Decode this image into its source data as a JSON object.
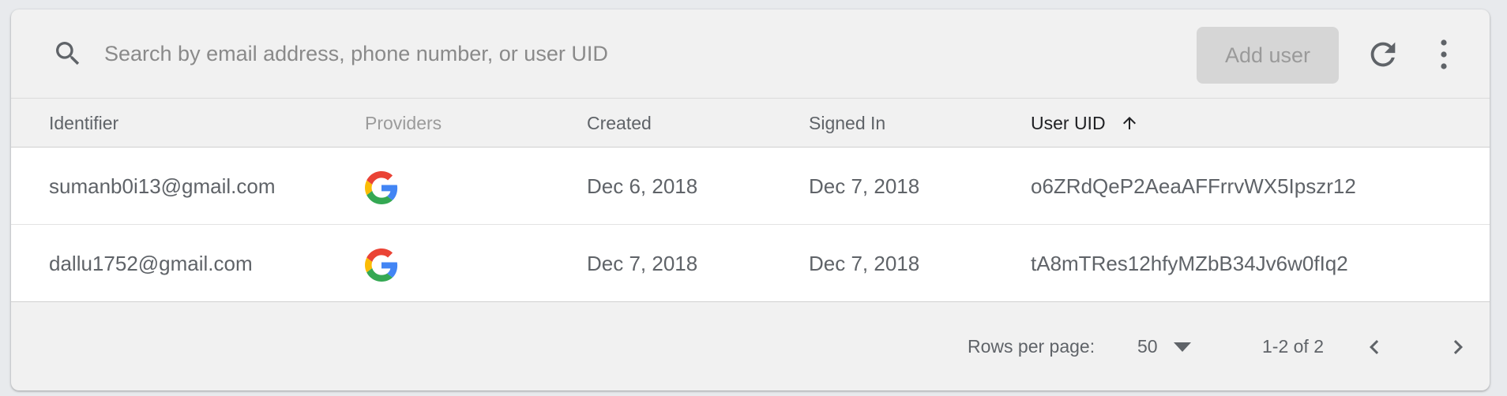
{
  "search": {
    "placeholder": "Search by email address, phone number, or user UID",
    "value": ""
  },
  "toolbar": {
    "add_user_label": "Add user",
    "add_user_enabled": false,
    "refresh_icon": "refresh-icon",
    "more_icon": "more-vert-icon"
  },
  "table": {
    "columns": [
      {
        "label": "Identifier"
      },
      {
        "label": "Providers"
      },
      {
        "label": "Created"
      },
      {
        "label": "Signed In"
      },
      {
        "label": "User UID",
        "sorted": "ascending"
      }
    ],
    "rows": [
      {
        "identifier": "sumanb0i13@gmail.com",
        "provider_icon": "google-icon",
        "created": "Dec 6, 2018",
        "signed_in": "Dec 7, 2018",
        "uid": "o6ZRdQeP2AeaAFFrrvWX5Ipszr12"
      },
      {
        "identifier": "dallu1752@gmail.com",
        "provider_icon": "google-icon",
        "created": "Dec 7, 2018",
        "signed_in": "Dec 7, 2018",
        "uid": "tA8mTRes12hfyMZbB34Jv6w0fIq2"
      }
    ]
  },
  "pagination": {
    "rows_per_page_label": "Rows per page:",
    "rows_per_page_value": "50",
    "range_label": "1-2 of 2"
  },
  "colors": {
    "card_background": "#f1f1f1",
    "table_background": "#ffffff",
    "active_header": "#202124",
    "text_secondary": "#5f6368",
    "disabled_button": "#d6d6d6"
  }
}
